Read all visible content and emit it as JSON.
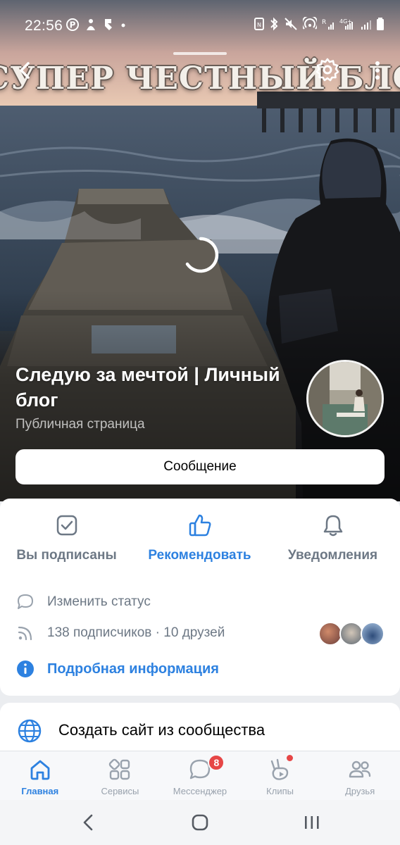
{
  "status_bar": {
    "time": "22:56",
    "left_icons": [
      "pinterest-icon",
      "notification-icon",
      "app-icon",
      "dot-icon"
    ],
    "right_icons": [
      "nfc-icon",
      "bluetooth-icon",
      "mute-icon",
      "hotspot-icon",
      "signal-r-icon",
      "4g-signal-icon",
      "signal-icon",
      "battery-icon"
    ],
    "network_label": "4G+"
  },
  "cover": {
    "banner_text": "СУПЕР ЧЕСТНЫЙ БЛОГ",
    "group_title": "Следую за мечтой | Личный блог",
    "group_type": "Публичная страница",
    "message_button": "Сообщение",
    "loading": true
  },
  "actions": [
    {
      "label": "Вы подписаны",
      "icon": "check-square-icon",
      "accent": false
    },
    {
      "label": "Рекомендовать",
      "icon": "thumbs-up-icon",
      "accent": true
    },
    {
      "label": "Уведомления",
      "icon": "bell-icon",
      "accent": false
    }
  ],
  "info": {
    "status_label": "Изменить статус",
    "subscribers_label": "138 подписчиков · 10 друзей",
    "details_label": "Подробная информация"
  },
  "site_card": {
    "label": "Создать сайт из сообщества",
    "icon": "globe-icon"
  },
  "tabs": [
    {
      "label": "Главная",
      "icon": "home-icon",
      "active": true
    },
    {
      "label": "Сервисы",
      "icon": "services-icon",
      "active": false
    },
    {
      "label": "Мессенджер",
      "icon": "messenger-icon",
      "active": false,
      "badge": "8"
    },
    {
      "label": "Клипы",
      "icon": "clips-icon",
      "active": false,
      "dot": true
    },
    {
      "label": "Друзья",
      "icon": "friends-icon",
      "active": false
    }
  ],
  "colors": {
    "accent": "#2d81e0",
    "secondary_text": "#6d7885",
    "badge": "#e64646",
    "page_background": "#ebedf0"
  }
}
